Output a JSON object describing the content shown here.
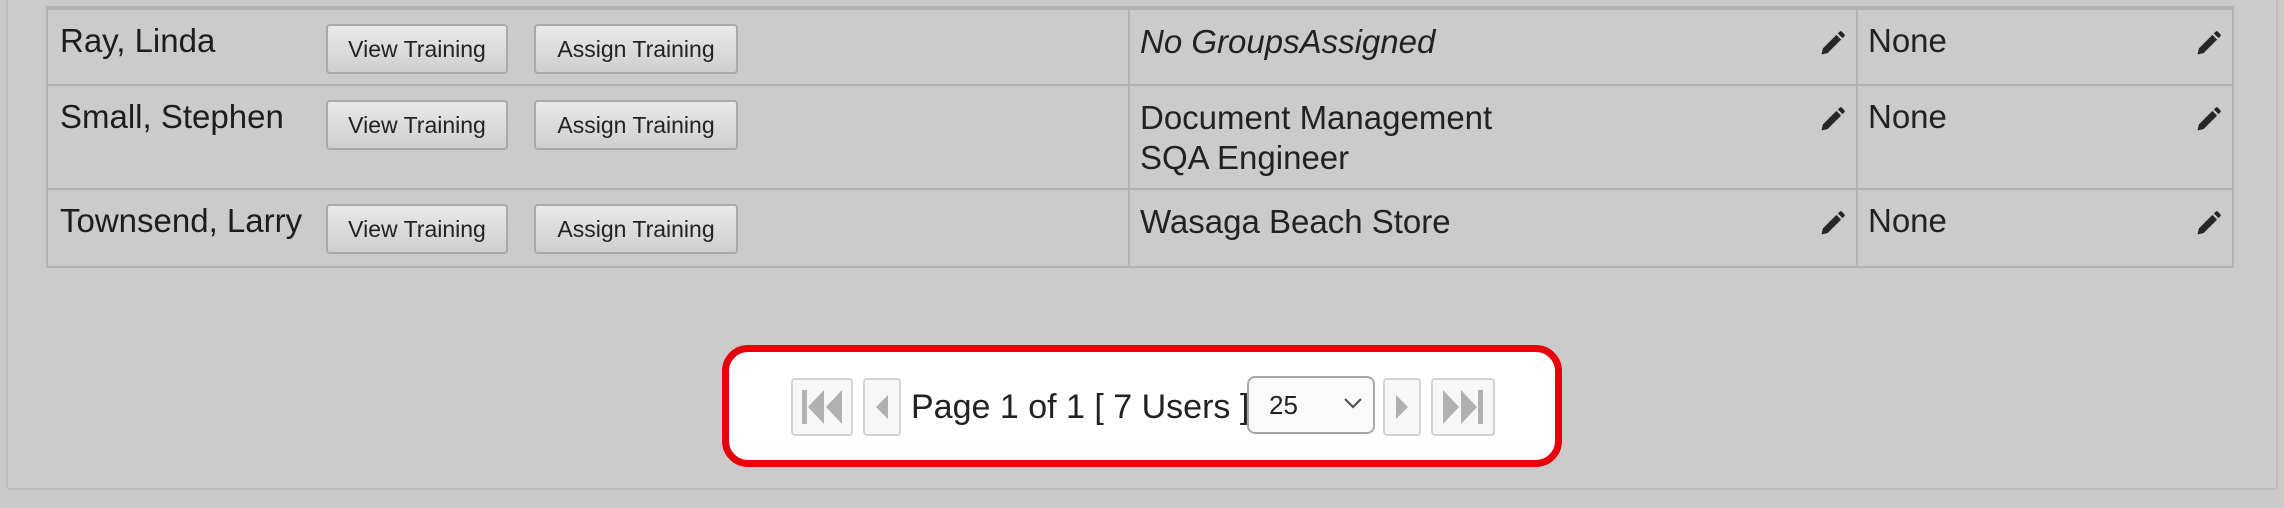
{
  "users_table": {
    "rows": [
      {
        "name": "Ray, Linda",
        "view_label": "View Training",
        "assign_label": "Assign Training",
        "groups": [
          "No GroupsAssigned"
        ],
        "groups_empty": true,
        "roles": "None"
      },
      {
        "name": "Small, Stephen",
        "view_label": "View Training",
        "assign_label": "Assign Training",
        "groups": [
          "Document Management",
          "SQA Engineer"
        ],
        "groups_empty": false,
        "roles": "None"
      },
      {
        "name": "Townsend, Larry",
        "view_label": "View Training",
        "assign_label": "Assign Training",
        "groups": [
          "Wasaga Beach Store"
        ],
        "groups_empty": false,
        "roles": "None"
      }
    ],
    "edit_icon": "pencil-icon"
  },
  "pager": {
    "status_text": "Page 1 of 1 [ 7 Users ]",
    "page_size": "25",
    "first_icon": "first-page-icon",
    "prev_icon": "previous-page-icon",
    "next_icon": "next-page-icon",
    "last_icon": "last-page-icon",
    "highlight_color": "#e8000a"
  }
}
